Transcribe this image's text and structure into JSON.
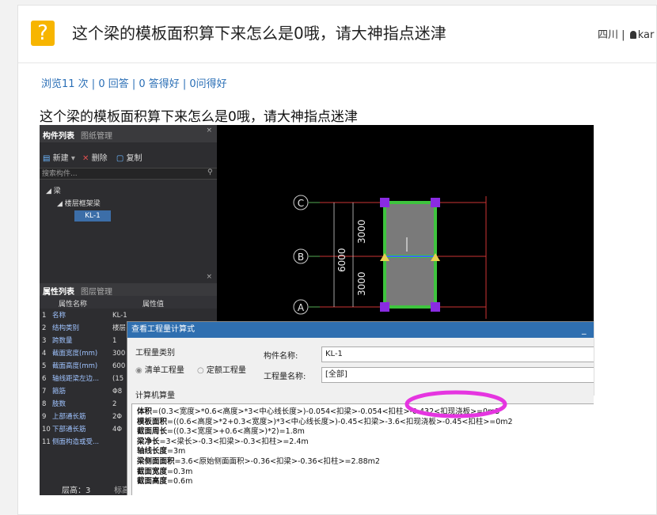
{
  "header": {
    "question_icon": "?",
    "title": "这个梁的模板面积算下来怎么是0哦，请大神指点迷津",
    "region": "四川",
    "separator": "|",
    "user": "kar"
  },
  "stats": {
    "text": "浏览11 次 | 0 回答 | 0 答得好 | 0问得好"
  },
  "question_body": "这个梁的模板面积算下来怎么是0哦，请大神指点迷津",
  "screenshot": {
    "component_panel": {
      "tab_active": "构件列表",
      "tab_other": "图纸管理",
      "new_btn": "新建",
      "delete_btn": "删除",
      "copy_btn": "复制",
      "search_placeholder": "搜索构件...",
      "tree_root": "梁",
      "tree_child": "楼层框架梁",
      "tree_leaf": "KL-1"
    },
    "property_panel": {
      "tab_active": "属性列表",
      "tab_other": "图层管理",
      "col_name": "属性名称",
      "col_value": "属性值",
      "rows": [
        {
          "n": "1",
          "k": "名称",
          "v": "KL-1"
        },
        {
          "n": "2",
          "k": "结构类别",
          "v": "楼层"
        },
        {
          "n": "3",
          "k": "跨数量",
          "v": "1"
        },
        {
          "n": "4",
          "k": "截面宽度(mm)",
          "v": "300"
        },
        {
          "n": "5",
          "k": "截面高度(mm)",
          "v": "600"
        },
        {
          "n": "6",
          "k": "轴线距梁左边...",
          "v": "(15"
        },
        {
          "n": "7",
          "k": "箍筋",
          "v": "Φ8"
        },
        {
          "n": "8",
          "k": "肢数",
          "v": "2"
        },
        {
          "n": "9",
          "k": "上部通长筋",
          "v": "2Φ"
        },
        {
          "n": "10",
          "k": "下部通长筋",
          "v": "4Φ"
        },
        {
          "n": "11",
          "k": "侧面构造或受...",
          "v": ""
        }
      ],
      "floor_label": "层高：3",
      "floor_extra": "标高"
    },
    "cad": {
      "axis_c": "C",
      "axis_b": "B",
      "axis_a": "A",
      "dim_top": "3000",
      "dim_bottom": "3000",
      "dim_total": "6000"
    },
    "dialog": {
      "title": "查看工程量计算式",
      "minimize": "_",
      "qty_type_label": "工程量类别",
      "radio_list": "清单工程量",
      "radio_quota": "定额工程量",
      "component_name_label": "构件名称:",
      "component_name_value": "KL-1",
      "qty_name_label": "工程量名称:",
      "qty_name_value": "[全部]",
      "calc_label": "计算机算量",
      "lines": [
        {
          "k": "体积",
          "v": "=(0.3<宽度>*0.6<高度>*3<中心线长度>)-0.054<扣梁>-0.054<扣柱>-0.432<扣现浇板>=0m3"
        },
        {
          "k": "模板面积",
          "v": "=((0.6<高度>*2+0.3<宽度>)*3<中心线长度>)-0.45<扣梁>-3.6<扣现浇板>-0.45<扣柱>=0m2"
        },
        {
          "k": "截面周长",
          "v": "=((0.3<宽度>+0.6<高度>)*2)=1.8m"
        },
        {
          "k": "梁净长",
          "v": "=3<梁长>-0.3<扣梁>-0.3<扣柱>=2.4m"
        },
        {
          "k": "轴线长度",
          "v": "=3m"
        },
        {
          "k": "梁侧面面积",
          "v": "=3.6<原始侧面面积>-0.36<扣梁>-0.36<扣柱>=2.88m2"
        },
        {
          "k": "截面宽度",
          "v": "=0.3m"
        },
        {
          "k": "截面高度",
          "v": "=0.6m"
        }
      ]
    }
  },
  "colors": {
    "accent_icon": "#f7b500",
    "link": "#2b6fb6",
    "dialog_title": "#2f6fb0",
    "highlight_ellipse": "#e535e0",
    "beam_green": "#3ec43e",
    "grip_purple": "#8a2be2"
  }
}
